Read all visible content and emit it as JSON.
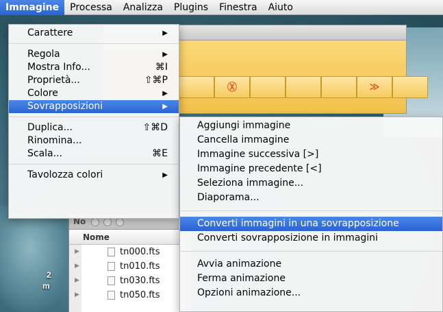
{
  "menubar": {
    "items": [
      "Immagine",
      "Processa",
      "Analizza",
      "Plugins",
      "Finestra",
      "Aiuto"
    ]
  },
  "background_window": {
    "toolbar_icons": [
      "stop-icon",
      "forward-icon"
    ],
    "toolbar_glyphs": [
      "Ⓧ",
      "≫"
    ]
  },
  "desktop": {
    "labels": [
      "2",
      "m"
    ]
  },
  "finder": {
    "title_fragment": "No",
    "column_header": "Nome",
    "files": [
      "tn000.fts",
      "tn010.fts",
      "tn030.fts",
      "tn050.fts"
    ]
  },
  "image_menu": {
    "items": [
      {
        "label": "Carattere",
        "shortcut": "",
        "submenu": true
      },
      {
        "label": "Regola",
        "shortcut": "",
        "submenu": true
      },
      {
        "label": "Mostra Info...",
        "shortcut": "⌘I",
        "submenu": false
      },
      {
        "label": "Proprietà...",
        "shortcut": "⇧⌘P",
        "submenu": false
      },
      {
        "label": "Colore",
        "shortcut": "",
        "submenu": true
      },
      {
        "label": "Sovrapposizioni",
        "shortcut": "",
        "submenu": true
      },
      {
        "label": "Duplica...",
        "shortcut": "⇧⌘D",
        "submenu": false
      },
      {
        "label": "Rinomina...",
        "shortcut": "",
        "submenu": false
      },
      {
        "label": "Scala...",
        "shortcut": "⌘E",
        "submenu": false
      },
      {
        "label": "Tavolozza colori",
        "shortcut": "",
        "submenu": true
      }
    ],
    "arrow_glyph": "▶"
  },
  "overlay_submenu": {
    "items": [
      "Aggiungi immagine",
      "Cancella immagine",
      "Immagine successiva [>]",
      "Immagine precedente [<]",
      "Seleziona immagine...",
      "Diaporama...",
      "Converti immagini in una sovrapposizione",
      "Converti sovrapposizione in immagini",
      "Avvia animazione",
      "Ferma animazione",
      "Opzioni animazione..."
    ]
  },
  "colors": {
    "menu_highlight": "#2a63d6",
    "toolbar_bg": "#f6cc60",
    "toolbar_glyph": "#e0512a"
  }
}
